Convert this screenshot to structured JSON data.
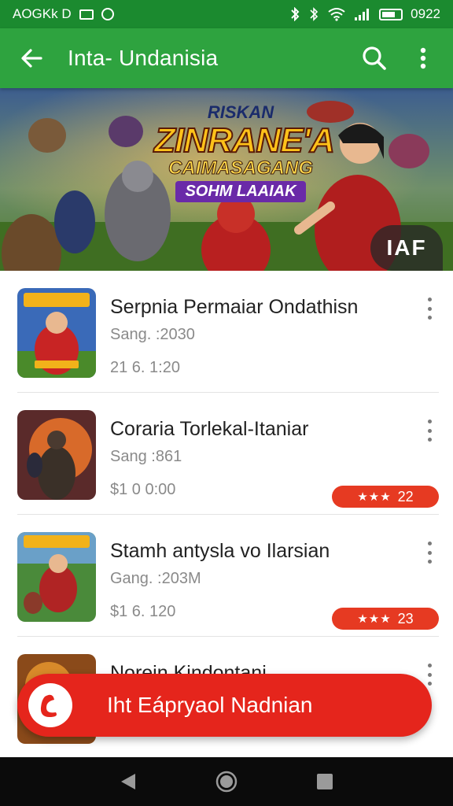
{
  "status_bar": {
    "left_text": "AOGKk D",
    "time": "0922"
  },
  "app_bar": {
    "title": "Inta- Undanisia",
    "back_icon": "arrow-back-icon",
    "search_icon": "search-icon",
    "more_icon": "more-vertical-icon"
  },
  "banner": {
    "line1": "RISKAN",
    "line2": "ZINRANE'A",
    "line3": "CAIMASAGANG",
    "line4": "SOHM LAAIAK",
    "badge": "IAF"
  },
  "items": [
    {
      "title": "Serpnia Permaiar Ondathisn",
      "subtitle": "Sang. :2030",
      "price": "21 6. 1:20"
    },
    {
      "title": "Coraria Torlekal-Itaniar",
      "subtitle": "Sang :861",
      "price": "$1 0 0:00",
      "rating": "22"
    },
    {
      "title": "Stamh antysla vo Ilarsian",
      "subtitle": "Gang. :203M",
      "price": "$1 6. 120",
      "rating": "23"
    },
    {
      "title": "Norein Kindontani"
    }
  ],
  "fab": {
    "label": "Iht Eápryaol Nadnian",
    "icon": "app-logo-icon"
  },
  "colors": {
    "status_bar": "#1b8a2f",
    "app_bar": "#2ea33f",
    "accent_red": "#e5251c",
    "nav_bar": "#0b0b0b"
  }
}
